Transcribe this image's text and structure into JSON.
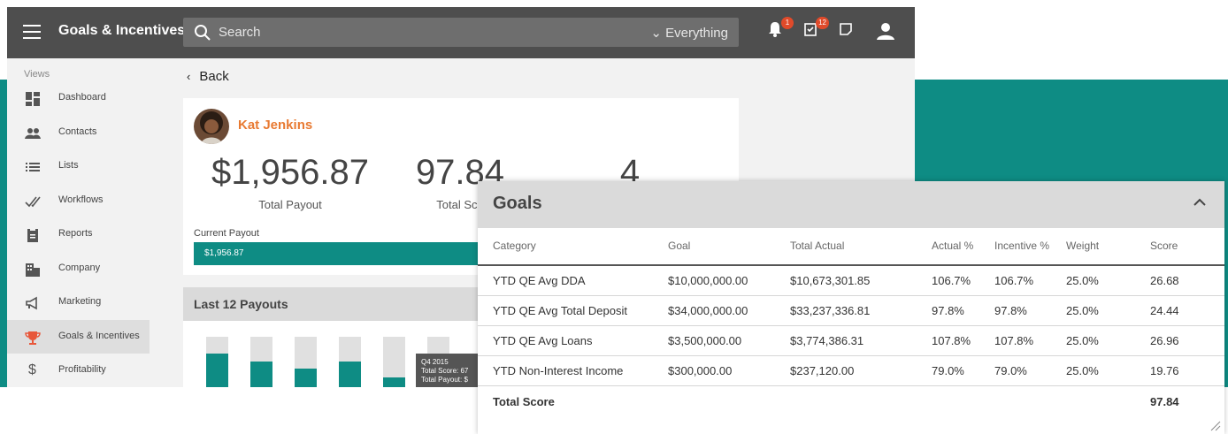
{
  "app": {
    "title": "Goals & Incentives",
    "search": {
      "placeholder": "Search",
      "scope": "Everything"
    },
    "notifications_count": "1",
    "tasks_count": "12"
  },
  "sidebar": {
    "section_label": "Views",
    "items": [
      {
        "label": "Dashboard",
        "icon": "dashboard-icon"
      },
      {
        "label": "Contacts",
        "icon": "contacts-icon"
      },
      {
        "label": "Lists",
        "icon": "list-icon"
      },
      {
        "label": "Workflows",
        "icon": "workflows-icon"
      },
      {
        "label": "Reports",
        "icon": "clipboard-icon"
      },
      {
        "label": "Company",
        "icon": "building-icon"
      },
      {
        "label": "Marketing",
        "icon": "megaphone-icon"
      },
      {
        "label": "Goals & Incentives",
        "icon": "trophy-icon",
        "active": true
      },
      {
        "label": "Profitability",
        "icon": "dollar-icon"
      }
    ]
  },
  "back_label": "Back",
  "profile": {
    "name": "Kat Jenkins",
    "total_payout": "$1,956.87",
    "total_payout_label": "Total Payout",
    "total_score": "97.84",
    "total_score_label": "Total Sco",
    "count": "4",
    "current_payout_label": "Current Payout",
    "current_payout_value": "$1,956.87",
    "current_payout_fraction": 1.0
  },
  "payouts": {
    "title": "Last 12 Payouts",
    "bar_fill_fractions": [
      0.68,
      0.54,
      0.4,
      0.54,
      0.24,
      0.2
    ],
    "tooltip": {
      "line1": "Q4 2015",
      "line2": "Total Score: 67",
      "line3": "Total Payout: $"
    }
  },
  "goals": {
    "title": "Goals",
    "columns": [
      "Category",
      "Goal",
      "Total Actual",
      "Actual %",
      "Incentive %",
      "Weight",
      "Score"
    ],
    "rows": [
      [
        "YTD QE Avg DDA",
        "$10,000,000.00",
        "$10,673,301.85",
        "106.7%",
        "106.7%",
        "25.0%",
        "26.68"
      ],
      [
        "YTD QE Avg Total Deposit",
        "$34,000,000.00",
        "$33,237,336.81",
        "97.8%",
        "97.8%",
        "25.0%",
        "24.44"
      ],
      [
        "YTD QE Avg Loans",
        "$3,500,000.00",
        "$3,774,386.31",
        "107.8%",
        "107.8%",
        "25.0%",
        "26.96"
      ],
      [
        "YTD Non-Interest Income",
        "$300,000.00",
        "$237,120.00",
        "79.0%",
        "79.0%",
        "25.0%",
        "19.76"
      ]
    ],
    "total_label": "Total Score",
    "total_value": "97.84"
  },
  "colors": {
    "teal": "#0e8c84",
    "topbar": "#4e4e4e",
    "name_accent": "#e87a32",
    "badge": "#e04a2a"
  }
}
